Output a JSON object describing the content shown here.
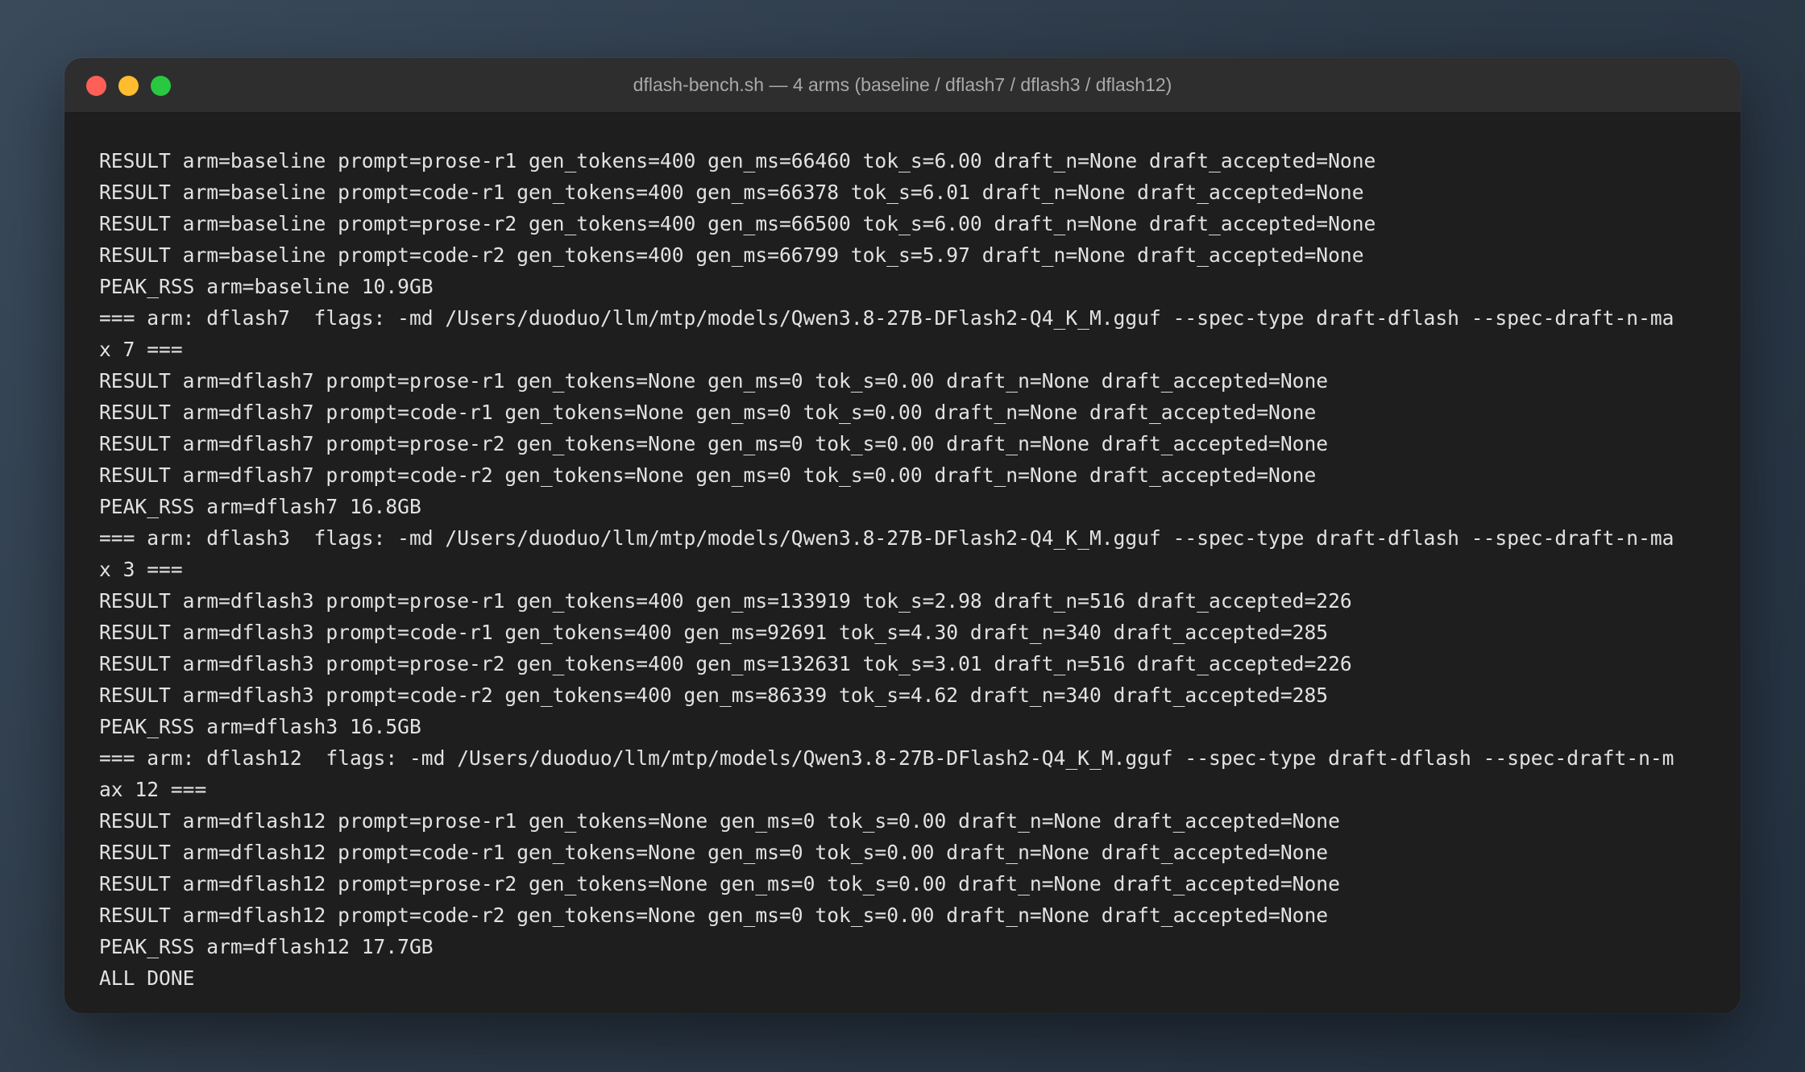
{
  "window": {
    "title": "dflash-bench.sh — 4 arms (baseline / dflash7 / dflash3 / dflash12)"
  },
  "colors": {
    "close": "#ff5f57",
    "minimize": "#febc2e",
    "zoom": "#28c840",
    "terminal_bg": "#1e1e1e",
    "text": "#e2e2e2"
  },
  "terminal": {
    "lines": [
      "RESULT arm=baseline prompt=prose-r1 gen_tokens=400 gen_ms=66460 tok_s=6.00 draft_n=None draft_accepted=None",
      "RESULT arm=baseline prompt=code-r1 gen_tokens=400 gen_ms=66378 tok_s=6.01 draft_n=None draft_accepted=None",
      "RESULT arm=baseline prompt=prose-r2 gen_tokens=400 gen_ms=66500 tok_s=6.00 draft_n=None draft_accepted=None",
      "RESULT arm=baseline prompt=code-r2 gen_tokens=400 gen_ms=66799 tok_s=5.97 draft_n=None draft_accepted=None",
      "PEAK_RSS arm=baseline 10.9GB",
      "=== arm: dflash7  flags: -md /Users/duoduo/llm/mtp/models/Qwen3.8-27B-DFlash2-Q4_K_M.gguf --spec-type draft-dflash --spec-draft-n-ma",
      "x 7 ===",
      "RESULT arm=dflash7 prompt=prose-r1 gen_tokens=None gen_ms=0 tok_s=0.00 draft_n=None draft_accepted=None",
      "RESULT arm=dflash7 prompt=code-r1 gen_tokens=None gen_ms=0 tok_s=0.00 draft_n=None draft_accepted=None",
      "RESULT arm=dflash7 prompt=prose-r2 gen_tokens=None gen_ms=0 tok_s=0.00 draft_n=None draft_accepted=None",
      "RESULT arm=dflash7 prompt=code-r2 gen_tokens=None gen_ms=0 tok_s=0.00 draft_n=None draft_accepted=None",
      "PEAK_RSS arm=dflash7 16.8GB",
      "=== arm: dflash3  flags: -md /Users/duoduo/llm/mtp/models/Qwen3.8-27B-DFlash2-Q4_K_M.gguf --spec-type draft-dflash --spec-draft-n-ma",
      "x 3 ===",
      "RESULT arm=dflash3 prompt=prose-r1 gen_tokens=400 gen_ms=133919 tok_s=2.98 draft_n=516 draft_accepted=226",
      "RESULT arm=dflash3 prompt=code-r1 gen_tokens=400 gen_ms=92691 tok_s=4.30 draft_n=340 draft_accepted=285",
      "RESULT arm=dflash3 prompt=prose-r2 gen_tokens=400 gen_ms=132631 tok_s=3.01 draft_n=516 draft_accepted=226",
      "RESULT arm=dflash3 prompt=code-r2 gen_tokens=400 gen_ms=86339 tok_s=4.62 draft_n=340 draft_accepted=285",
      "PEAK_RSS arm=dflash3 16.5GB",
      "=== arm: dflash12  flags: -md /Users/duoduo/llm/mtp/models/Qwen3.8-27B-DFlash2-Q4_K_M.gguf --spec-type draft-dflash --spec-draft-n-m",
      "ax 12 ===",
      "RESULT arm=dflash12 prompt=prose-r1 gen_tokens=None gen_ms=0 tok_s=0.00 draft_n=None draft_accepted=None",
      "RESULT arm=dflash12 prompt=code-r1 gen_tokens=None gen_ms=0 tok_s=0.00 draft_n=None draft_accepted=None",
      "RESULT arm=dflash12 prompt=prose-r2 gen_tokens=None gen_ms=0 tok_s=0.00 draft_n=None draft_accepted=None",
      "RESULT arm=dflash12 prompt=code-r2 gen_tokens=None gen_ms=0 tok_s=0.00 draft_n=None draft_accepted=None",
      "PEAK_RSS arm=dflash12 17.7GB",
      "ALL DONE"
    ]
  }
}
